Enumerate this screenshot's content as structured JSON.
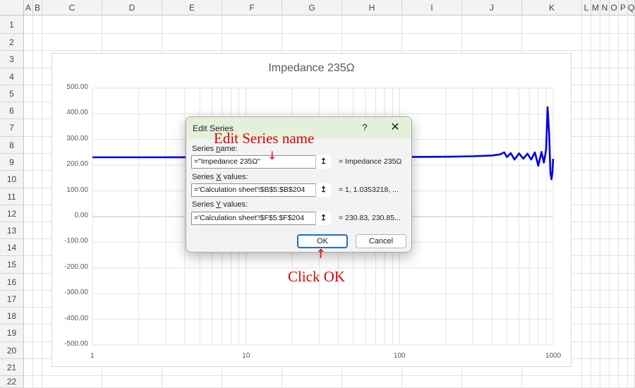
{
  "spreadsheet": {
    "columns": [
      "A",
      "B",
      "C",
      "D",
      "E",
      "F",
      "G",
      "H",
      "I",
      "J",
      "K",
      "L",
      "M",
      "N",
      "O",
      "P",
      "Q"
    ],
    "rows": [
      "1",
      "2",
      "3",
      "4",
      "5",
      "6",
      "7",
      "8",
      "9",
      "10",
      "11",
      "12",
      "13",
      "14",
      "15",
      "16",
      "17",
      "18",
      "19",
      "20",
      "21",
      "22"
    ]
  },
  "chart_data": {
    "type": "line",
    "title": "Impedance 235Ω",
    "x_scale": "log",
    "xlim": [
      1,
      1000
    ],
    "ylim": [
      -500,
      500
    ],
    "y_ticks": [
      "500.00",
      "400.00",
      "300.00",
      "200.00",
      "100.00",
      "0.00",
      "-100.00",
      "-200.00",
      "-300.00",
      "-400.00",
      "-500.00"
    ],
    "x_ticks": [
      "1",
      "10",
      "100",
      "1000"
    ],
    "grid": true,
    "series_color": "#0000e6",
    "series": [
      {
        "name": "Impedance 235Ω",
        "x": [
          1,
          2,
          5,
          10,
          20,
          50,
          100,
          200,
          300,
          400,
          450,
          480,
          500,
          530,
          560,
          600,
          640,
          680,
          720,
          760,
          800,
          840,
          870,
          900,
          920,
          940,
          960,
          975,
          990,
          1000
        ],
        "y": [
          230.83,
          230.85,
          231,
          231,
          231,
          231,
          232,
          233,
          235,
          238,
          242,
          250,
          232,
          247,
          222,
          246,
          225,
          245,
          222,
          250,
          198,
          252,
          210,
          260,
          426,
          330,
          170,
          145,
          175,
          225
        ]
      }
    ]
  },
  "dialog": {
    "title": "Edit Series",
    "help_label": "?",
    "close_label": "✕",
    "series_name_label_pre": "Series ",
    "series_name_label_key": "n",
    "series_name_label_post": "ame:",
    "series_name_value": "=\"Impedance 235Ω\"",
    "series_name_preview": "= Impedance 235Ω",
    "x_label_pre": "Series ",
    "x_label_key": "X",
    "x_label_post": " values:",
    "x_value": "='Calculation sheet'!$B$5:$B$204",
    "x_preview": "= 1, 1.0353218, ...",
    "y_label_pre": "Series ",
    "y_label_key": "Y",
    "y_label_post": " values:",
    "y_value": "='Calculation sheet'!$F$5:$F$204",
    "y_preview": "= 230.83, 230.85...",
    "ok_label": "OK",
    "cancel_label": "Cancel",
    "ref_icon": "↥"
  },
  "annotations": {
    "edit_series_name": "Edit Series name",
    "click_ok": "Click OK",
    "color": "#e00000"
  }
}
